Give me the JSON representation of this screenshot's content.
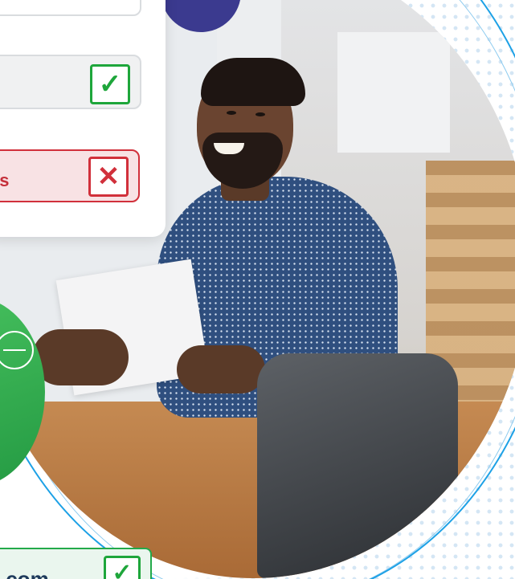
{
  "form_card": {
    "fields": [
      {
        "status": "valid",
        "icon": "check-icon"
      },
      {
        "status": "valid",
        "icon": "check-icon"
      },
      {
        "status": "invalid",
        "text": "ss",
        "icon": "x-icon"
      }
    ]
  },
  "green_badge": {
    "icon": "minus-circle-icon"
  },
  "email_chip": {
    "text": ".com",
    "icon": "check-icon"
  },
  "glyphs": {
    "check": "✓",
    "x": "✕"
  },
  "colors": {
    "valid": "#1ea63b",
    "invalid": "#d1303b",
    "ring": "#1da1e6",
    "accent": "#3b3a8f"
  }
}
